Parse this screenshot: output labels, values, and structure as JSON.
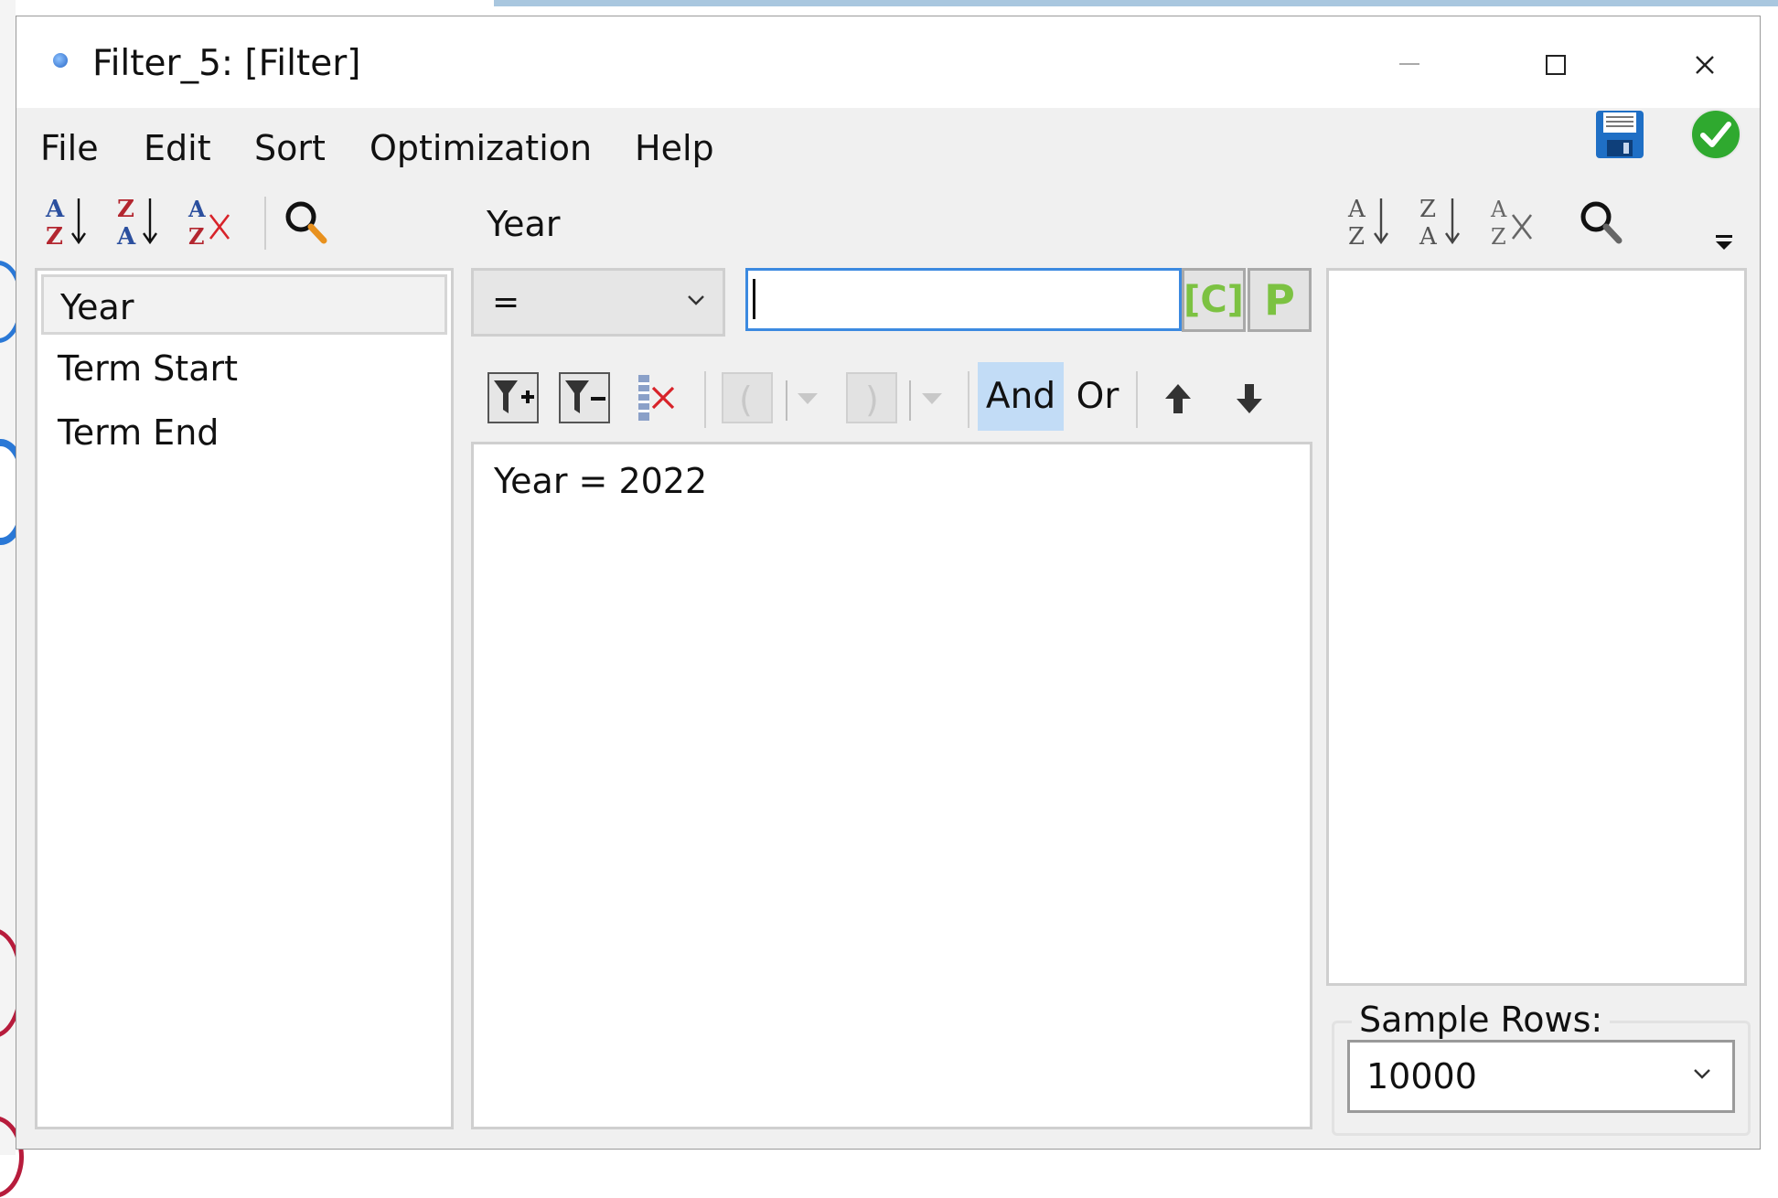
{
  "window": {
    "title": "Filter_5: [Filter]"
  },
  "menu": {
    "items": [
      "File",
      "Edit",
      "Sort",
      "Optimization",
      "Help"
    ]
  },
  "field_list": {
    "current_field": "Year",
    "items": [
      {
        "label": "Year",
        "selected": true
      },
      {
        "label": "Term Start",
        "selected": false
      },
      {
        "label": "Term End",
        "selected": false
      }
    ]
  },
  "condition": {
    "operator": "=",
    "value": "",
    "const_button": "[C]",
    "param_button": "P",
    "and_label": "And",
    "or_label": "Or"
  },
  "expression": {
    "text": "Year = 2022"
  },
  "sample": {
    "label": "Sample Rows:",
    "value": "10000"
  },
  "colors": {
    "accent": "#3c8ae0",
    "and_highlight": "#c2dcf6",
    "cp_green": "#7cc242",
    "ok_green": "#2fa92f"
  }
}
